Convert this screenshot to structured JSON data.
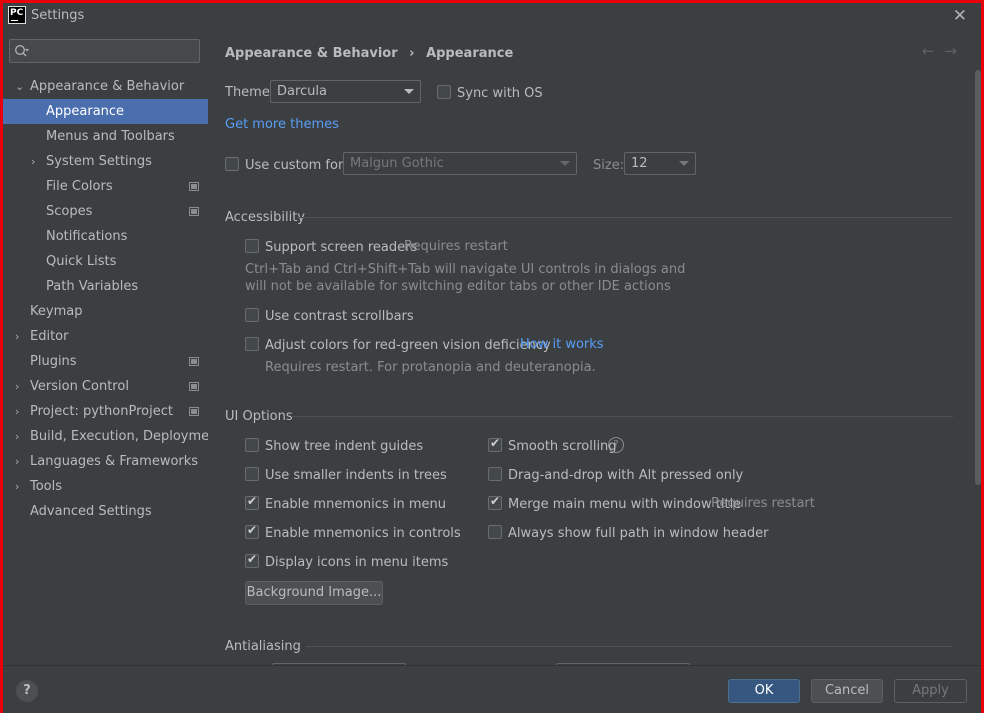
{
  "window": {
    "title": "Settings",
    "logo_text": "PC"
  },
  "sidebar": {
    "search_placeholder": "",
    "items": [
      {
        "label": "Appearance & Behavior"
      },
      {
        "label": "Appearance"
      },
      {
        "label": "Menus and Toolbars"
      },
      {
        "label": "System Settings"
      },
      {
        "label": "File Colors"
      },
      {
        "label": "Scopes"
      },
      {
        "label": "Notifications"
      },
      {
        "label": "Quick Lists"
      },
      {
        "label": "Path Variables"
      },
      {
        "label": "Keymap"
      },
      {
        "label": "Editor"
      },
      {
        "label": "Plugins"
      },
      {
        "label": "Version Control"
      },
      {
        "label": "Project: pythonProject"
      },
      {
        "label": "Build, Execution, Deployment"
      },
      {
        "label": "Languages & Frameworks"
      },
      {
        "label": "Tools"
      },
      {
        "label": "Advanced Settings"
      }
    ]
  },
  "breadcrumb": {
    "parent": "Appearance & Behavior",
    "separator": "›",
    "current": "Appearance"
  },
  "theme": {
    "label": "Theme:",
    "value": "Darcula",
    "sync_label": "Sync with OS",
    "more_themes": "Get more themes"
  },
  "font": {
    "custom_label": "Use custom font:",
    "font_value": "Malgun Gothic",
    "size_label": "Size:",
    "size_value": "12"
  },
  "accessibility": {
    "title": "Accessibility",
    "screen_readers": "Support screen readers",
    "requires_restart": "Requires restart",
    "note_line1": "Ctrl+Tab and Ctrl+Shift+Tab will navigate UI controls in dialogs and",
    "note_line2": "will not be available for switching editor tabs or other IDE actions",
    "contrast_scrollbars": "Use contrast scrollbars",
    "adjust_colors": "Adjust colors for red-green vision deficiency",
    "how_it_works": "How it works",
    "adjust_note": "Requires restart. For protanopia and deuteranopia."
  },
  "ui_options": {
    "title": "UI Options",
    "left": [
      {
        "label": "Show tree indent guides",
        "checked": false
      },
      {
        "label": "Use smaller indents in trees",
        "checked": false
      },
      {
        "label": "Enable mnemonics in menu",
        "checked": true
      },
      {
        "label": "Enable mnemonics in controls",
        "checked": true
      },
      {
        "label": "Display icons in menu items",
        "checked": true
      }
    ],
    "right": [
      {
        "label": "Smooth scrolling",
        "checked": true
      },
      {
        "label": "Drag-and-drop with Alt pressed only",
        "checked": false
      },
      {
        "label": "Merge main menu with window title",
        "checked": true
      },
      {
        "label": "Always show full path in window header",
        "checked": false
      }
    ],
    "merge_note": "Requires restart",
    "help_glyph": "?",
    "background_button": "Background Image..."
  },
  "antialiasing": {
    "title": "Antialiasing"
  },
  "footer": {
    "help": "?",
    "ok": "OK",
    "cancel": "Cancel",
    "apply": "Apply"
  }
}
